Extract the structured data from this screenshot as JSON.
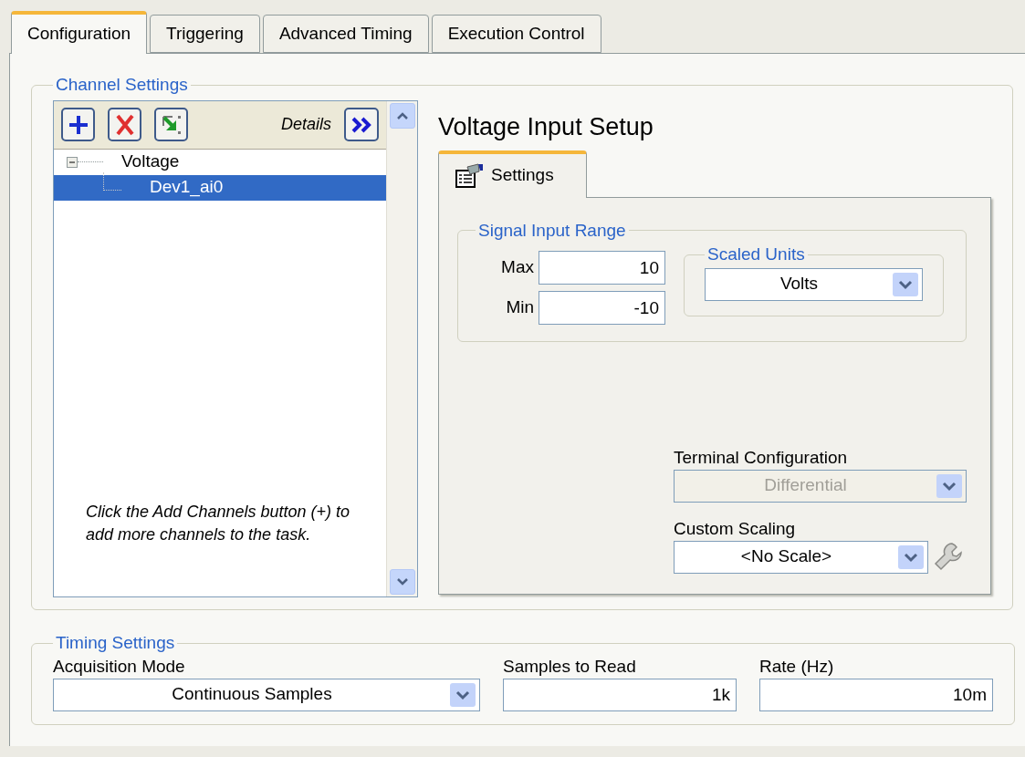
{
  "tabs": [
    {
      "label": "Configuration",
      "selected": true
    },
    {
      "label": "Triggering",
      "selected": false
    },
    {
      "label": "Advanced Timing",
      "selected": false
    },
    {
      "label": "Execution Control",
      "selected": false
    }
  ],
  "channel_settings": {
    "title": "Channel Settings",
    "details_label": "Details",
    "tree": [
      {
        "label": "Voltage",
        "expanded": true,
        "selected": false,
        "children": [
          {
            "label": "Dev1_ai0",
            "selected": true
          }
        ]
      }
    ],
    "hint": "Click the Add Channels button (+) to add more channels to the task."
  },
  "setup": {
    "title": "Voltage Input Setup",
    "tabs": [
      {
        "label": "Settings",
        "selected": true
      }
    ],
    "signal_input_range": {
      "title": "Signal Input Range",
      "max": {
        "label": "Max",
        "value": "10"
      },
      "min": {
        "label": "Min",
        "value": "-10"
      }
    },
    "scaled_units": {
      "title": "Scaled Units",
      "value": "Volts"
    },
    "terminal_configuration": {
      "label": "Terminal Configuration",
      "value": "Differential",
      "disabled": true
    },
    "custom_scaling": {
      "label": "Custom Scaling",
      "value": "<No Scale>",
      "disabled": false
    }
  },
  "timing_settings": {
    "title": "Timing Settings",
    "acquisition_mode": {
      "label": "Acquisition Mode",
      "value": "Continuous Samples"
    },
    "samples_to_read": {
      "label": "Samples to Read",
      "value": "1k"
    },
    "rate": {
      "label": "Rate (Hz)",
      "value": "10m"
    }
  }
}
